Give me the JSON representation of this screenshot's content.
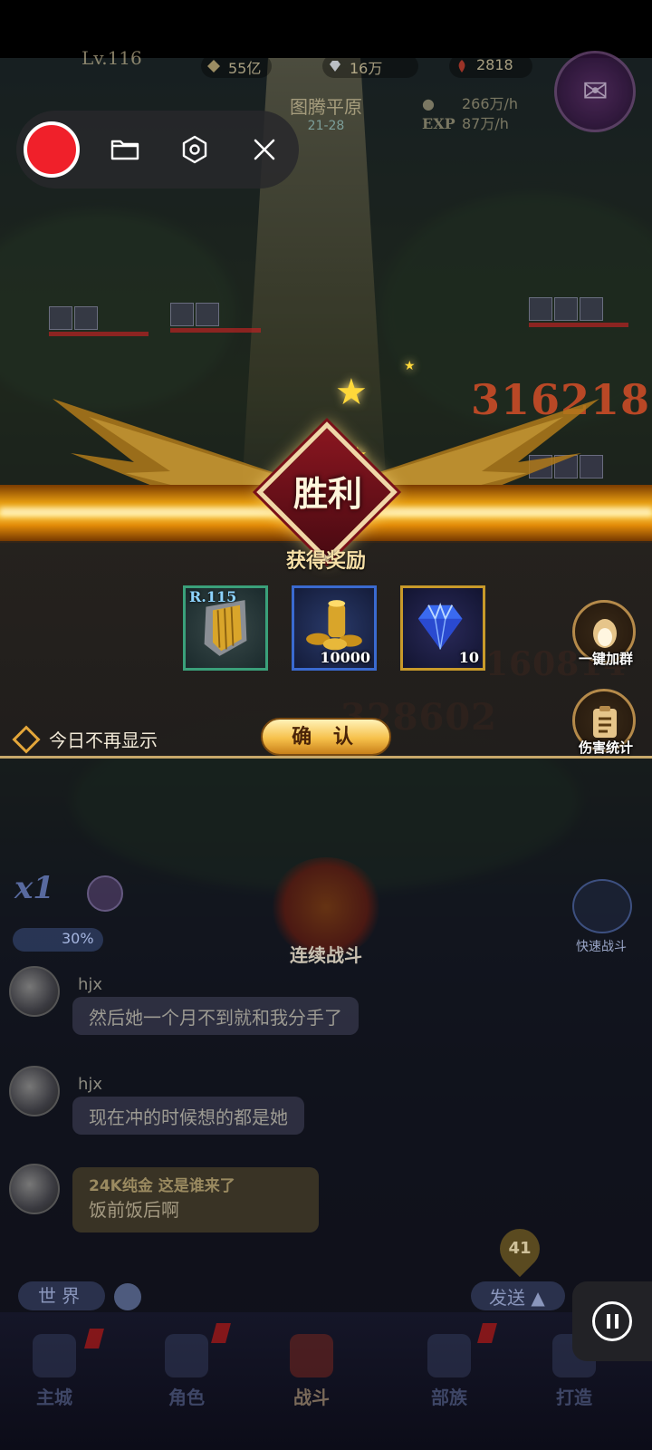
{
  "hud": {
    "level": "Lv.116",
    "power": "55亿",
    "diamonds": "16万",
    "rubies": "2818",
    "map_name": "图腾平原",
    "map_stage": "21-28",
    "gold_rate": "266万/h",
    "exp_label": "EXP",
    "exp_rate": "87万/h"
  },
  "recorder": {
    "record": "record",
    "folder": "folder",
    "settings": "settings",
    "close": "close"
  },
  "battle": {
    "damage_numbers": [
      "316218",
      "160814",
      "328602"
    ]
  },
  "victory": {
    "title": "胜利",
    "reward_title": "获得奖励",
    "rewards": [
      {
        "name": "shield",
        "level": "R.115",
        "count": "",
        "border": "#3aa07a"
      },
      {
        "name": "gold-coins",
        "level": "",
        "count": "10000",
        "border": "#3a6ad0"
      },
      {
        "name": "diamond",
        "level": "",
        "count": "10",
        "border": "#c89a2a"
      }
    ],
    "skip_today": "今日不再显示",
    "confirm": "确 认"
  },
  "side": {
    "join_group": "一键加群",
    "damage_stats": "伤害统计"
  },
  "controls": {
    "speed": "x1",
    "percent": "30%",
    "continuous_battle": "连续战斗",
    "quick_battle": "快速战斗"
  },
  "chat": [
    {
      "name": "hjx",
      "message": "然后她一个月不到就和我分手了",
      "style": "normal"
    },
    {
      "name": "hjx",
      "message": "现在冲的时候想的都是她",
      "style": "normal"
    },
    {
      "name": "24K纯金 这是谁来了",
      "message": "饭前饭后啊",
      "style": "gold"
    }
  ],
  "chat_bar": {
    "channel": "世界",
    "send": "发送",
    "unread": "41"
  },
  "nav": [
    {
      "label": "主城",
      "active": false
    },
    {
      "label": "角色",
      "active": false
    },
    {
      "label": "战斗",
      "active": true
    },
    {
      "label": "部族",
      "active": false
    },
    {
      "label": "打造",
      "active": false
    }
  ]
}
